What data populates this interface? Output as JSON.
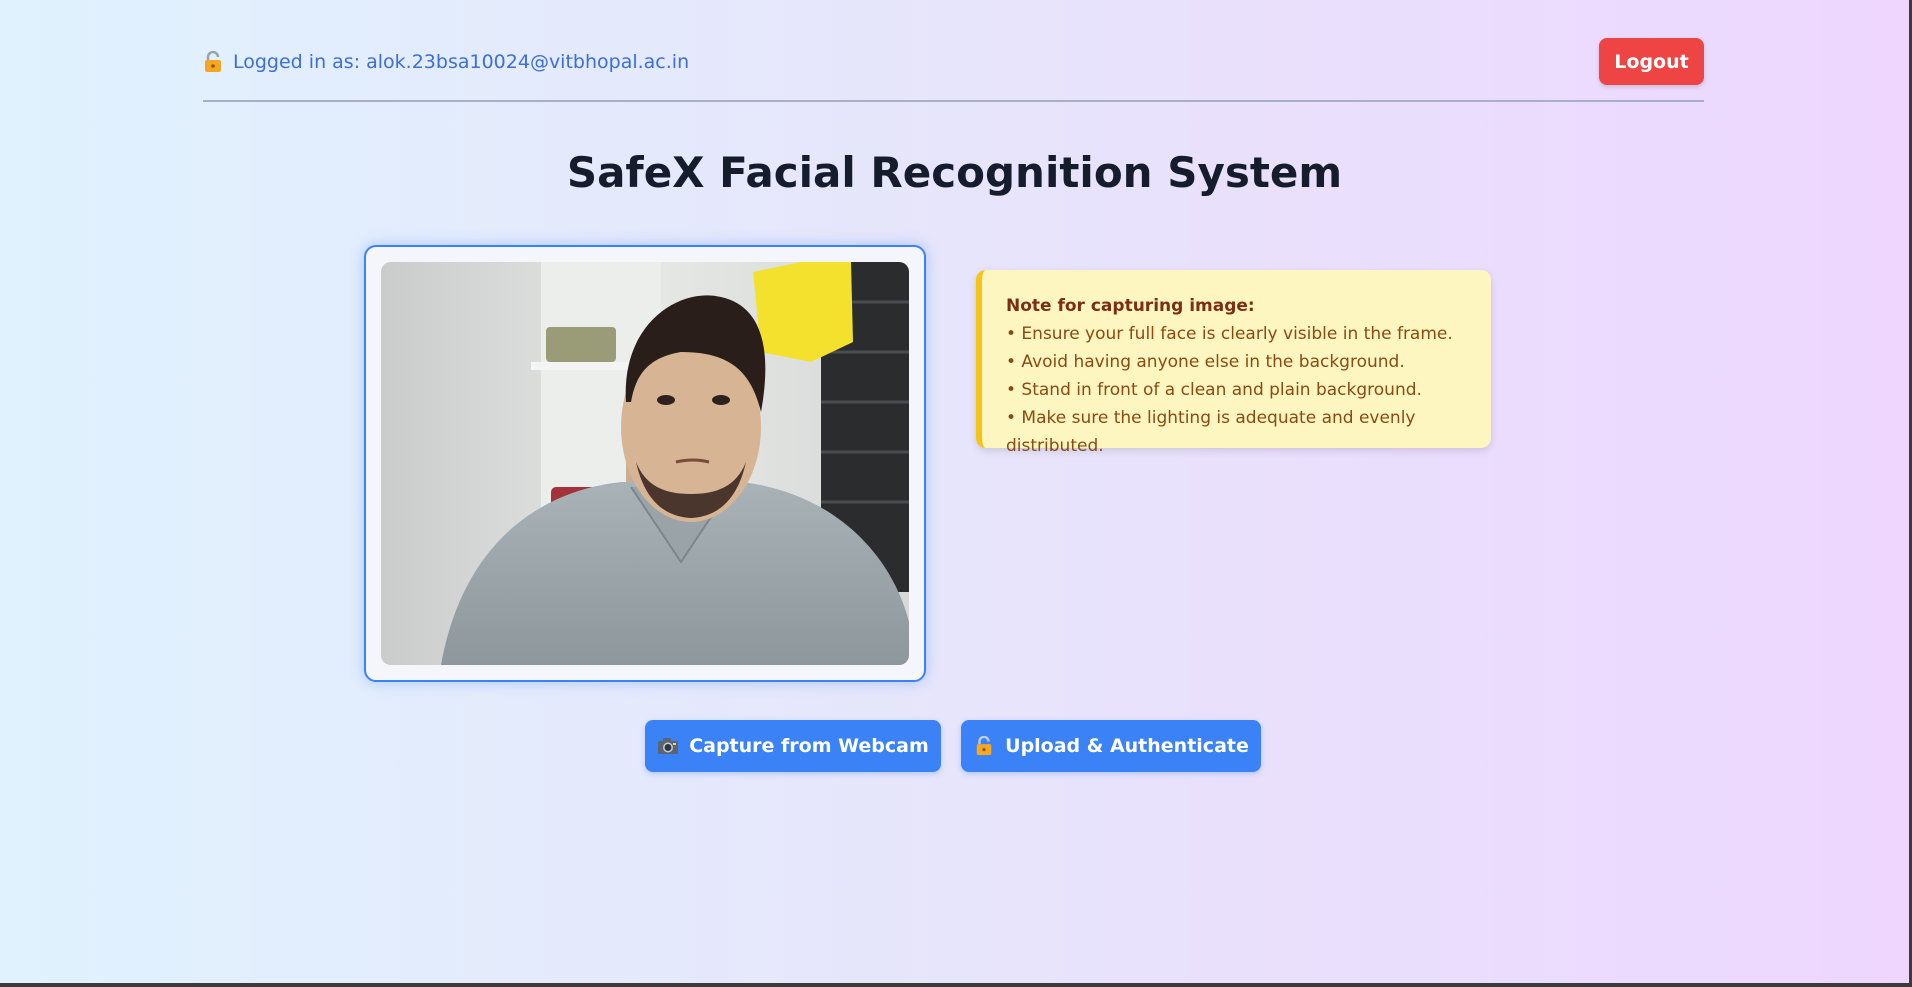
{
  "header": {
    "login_text": "Logged in as: alok.23bsa10024@vitbhopal.ac.in",
    "lock_icon": "lock-icon",
    "logout_label": "Logout"
  },
  "page_title": "SafeX Facial Recognition System",
  "note": {
    "title": "Note for capturing image:",
    "items": [
      "• Ensure your full face is clearly visible in the frame.",
      "• Avoid having anyone else in the background.",
      "• Stand in front of a clean and plain background.",
      "• Make sure the lighting is adequate and evenly distributed."
    ]
  },
  "buttons": {
    "capture_label": "Capture from Webcam",
    "capture_icon": "camera-icon",
    "upload_label": "Upload & Authenticate",
    "upload_icon": "lock-icon"
  },
  "colors": {
    "accent": "#3b82f6",
    "logout": "#ef4444",
    "note_bg": "#fef6c0",
    "note_border": "#f6c418",
    "login_text": "#3a6fd8"
  }
}
